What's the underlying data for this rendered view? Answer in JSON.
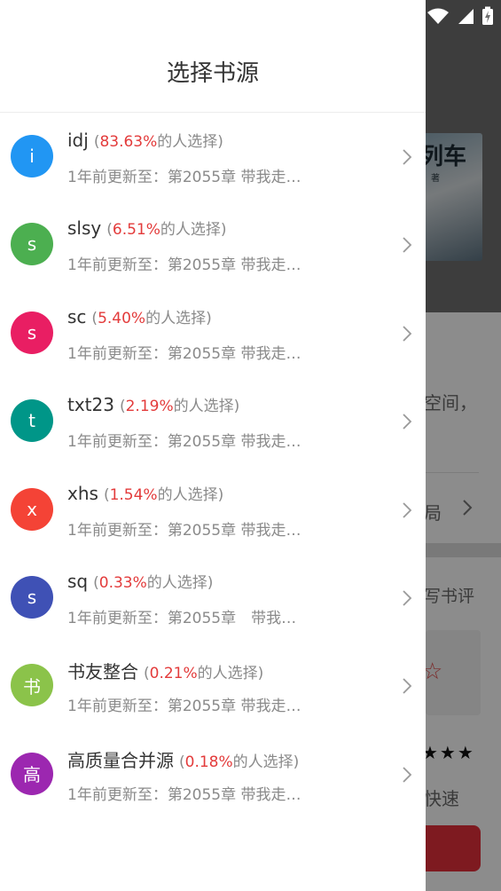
{
  "drawer": {
    "title": "选择书源"
  },
  "sources": [
    {
      "name": "idj",
      "initial": "i",
      "color": "#2196F3",
      "pct": "83.63%",
      "suffix": "的人选择)",
      "open": "(",
      "update": "1年前更新至：第2055章 带我走…"
    },
    {
      "name": "slsy",
      "initial": "s",
      "color": "#4CAF50",
      "pct": "6.51%",
      "suffix": "的人选择)",
      "open": "(",
      "update": "1年前更新至：第2055章 带我走…"
    },
    {
      "name": "sc",
      "initial": "s",
      "color": "#E91E63",
      "pct": "5.40%",
      "suffix": "的人选择)",
      "open": "(",
      "update": "1年前更新至：第2055章 带我走…"
    },
    {
      "name": "txt23",
      "initial": "t",
      "color": "#009688",
      "pct": "2.19%",
      "suffix": "的人选择)",
      "open": "(",
      "update": "1年前更新至：第2055章 带我走…"
    },
    {
      "name": "xhs",
      "initial": "x",
      "color": "#F44336",
      "pct": "1.54%",
      "suffix": "的人选择)",
      "open": "(",
      "update": "1年前更新至：第2055章 带我走…"
    },
    {
      "name": "sq",
      "initial": "s",
      "color": "#3F51B5",
      "pct": "0.33%",
      "suffix": "的人选择)",
      "open": "(",
      "update": "1年前更新至：第2055章　带我…"
    },
    {
      "name": "书友整合",
      "initial": "书",
      "color": "#8BC34A",
      "pct": "0.21%",
      "suffix": "的人选择)",
      "open": "(",
      "update": "1年前更新至：第2055章 带我走…"
    },
    {
      "name": "高质量合并源",
      "initial": "高",
      "color": "#9C27B0",
      "pct": "0.18%",
      "suffix": "的人选择)",
      "open": "(",
      "update": "1年前更新至：第2055章 带我走…"
    }
  ],
  "background": {
    "cover_title": "列车",
    "cover_author": "著",
    "text_space": "空间，",
    "text_ju": "局",
    "text_review": "写书评",
    "text_fast": "快速",
    "stars": "★★★"
  },
  "colors": {
    "accent": "#e33b3b",
    "button": "#e5303b"
  }
}
